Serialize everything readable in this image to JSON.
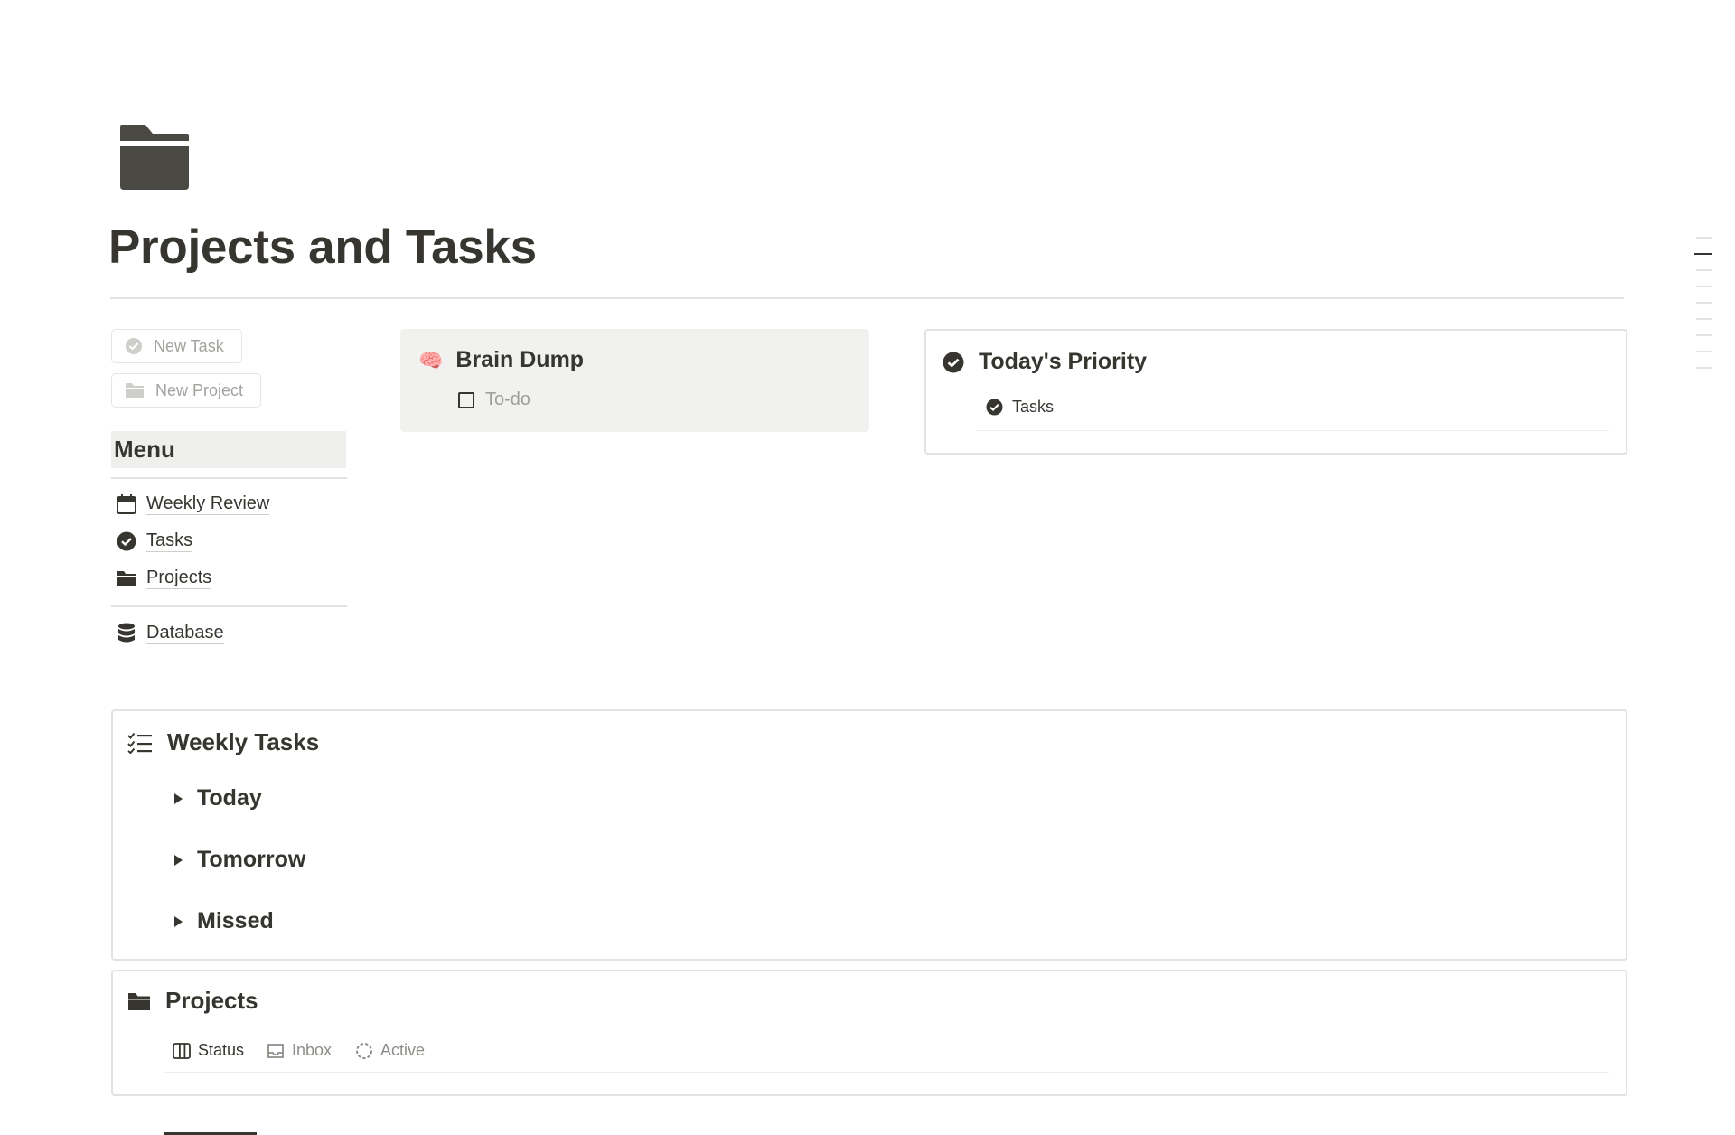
{
  "page": {
    "title": "Projects and Tasks",
    "icon": "folder-icon"
  },
  "buttons": {
    "new_task": "New Task",
    "new_project": "New Project"
  },
  "menu": {
    "heading": "Menu",
    "items": [
      {
        "label": "Weekly Review",
        "icon": "calendar-icon"
      },
      {
        "label": "Tasks",
        "icon": "check-circle-icon"
      },
      {
        "label": "Projects",
        "icon": "folder-icon"
      }
    ],
    "secondary": [
      {
        "label": "Database",
        "icon": "database-icon"
      }
    ]
  },
  "brain_dump": {
    "emoji": "🧠",
    "title": "Brain Dump",
    "todo_placeholder": "To-do"
  },
  "priority": {
    "title": "Today's Priority",
    "tab_label": "Tasks"
  },
  "weekly_tasks": {
    "title": "Weekly Tasks",
    "groups": [
      "Today",
      "Tomorrow",
      "Missed"
    ]
  },
  "projects": {
    "title": "Projects",
    "tabs": [
      {
        "label": "Status",
        "icon": "board-icon",
        "selected": true
      },
      {
        "label": "Inbox",
        "icon": "inbox-icon",
        "selected": false
      },
      {
        "label": "Active",
        "icon": "dashed-circle-icon",
        "selected": false
      }
    ]
  },
  "colors": {
    "text": "#37352f",
    "muted": "#a3a29e",
    "border": "#e3e2df",
    "callout_bg": "#f1f1ef"
  }
}
